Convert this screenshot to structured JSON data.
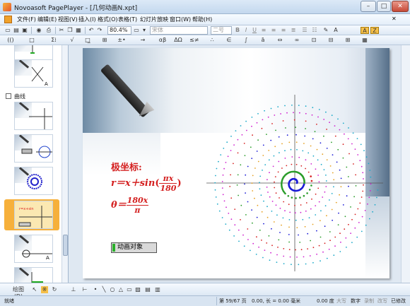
{
  "window": {
    "title": "Novoasoft PagePlayer - [几何动画N.xpt]"
  },
  "menubar": {
    "items": [
      "文件(F)",
      "编辑(E)",
      "视图(V)",
      "插入(I)",
      "格式(O)",
      "表格(T)",
      "幻灯片放映",
      "窗口(W)",
      "帮助(H)"
    ]
  },
  "toolbar": {
    "zoom": "80.4%",
    "font_name": "宋体",
    "font_size": "二号"
  },
  "sidebar": {
    "group_label": "曲线"
  },
  "slide": {
    "heading": "极坐标:",
    "eq1_lhs": "r＝x＋sin",
    "eq1_num": "πx",
    "eq1_den": "180",
    "eq2_lhs": "θ＝",
    "eq2_num": "180x",
    "eq2_den": "π",
    "anim_button": "动画对象"
  },
  "drawbar": {
    "label": "绘图(D)"
  },
  "statusbar": {
    "ready": "就绪",
    "page": "第 59/67 页",
    "pos": "0.00, 长 = 0.00 毫米",
    "size": "0.00 度",
    "caps": "大写",
    "num": "数字",
    "rec": "录制",
    "ovr": "改写",
    "sel": "已修改"
  },
  "colors": {
    "formula": "#d42020",
    "spiral_rings": [
      "#1a1ad6",
      "#2a9d2a",
      "#d62020",
      "#d020d0",
      "#1aa9c9",
      "#e6a020"
    ]
  }
}
